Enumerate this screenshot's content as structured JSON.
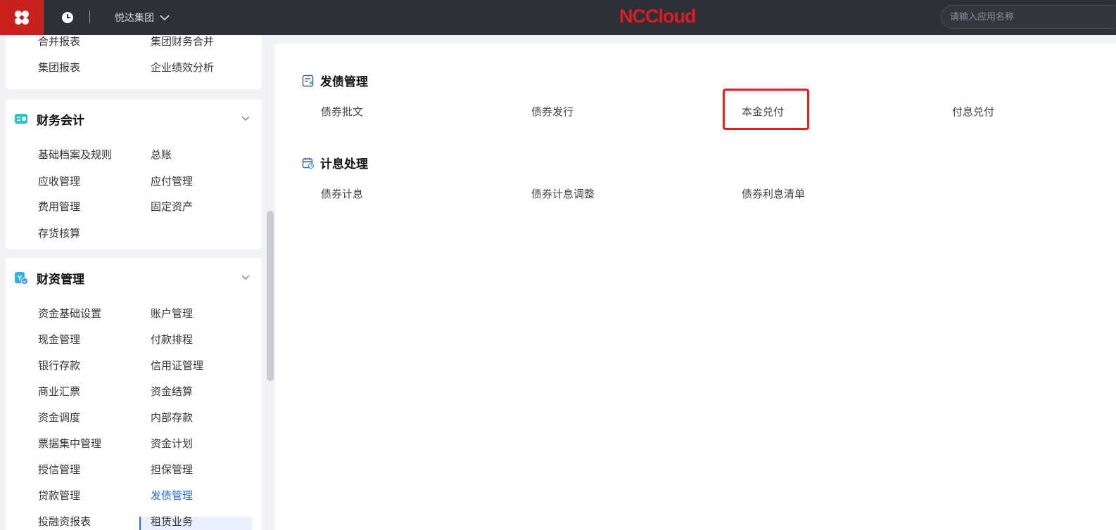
{
  "topbar": {
    "group_name": "悦达集团",
    "brand": "NCCloud",
    "search_placeholder": "请输入应用名称"
  },
  "sidebar": {
    "card0_items": [
      "合并报表",
      "集团财务合并",
      "集团报表",
      "企业绩效分析"
    ],
    "card1": {
      "title": "财务会计",
      "items": [
        "基础档案及规则",
        "总账",
        "应收管理",
        "应付管理",
        "费用管理",
        "固定资产",
        "存货核算"
      ]
    },
    "card2": {
      "title": "财资管理",
      "items": [
        "资金基础设置",
        "账户管理",
        "现金管理",
        "付款排程",
        "银行存款",
        "信用证管理",
        "商业汇票",
        "资金结算",
        "资金调度",
        "内部存款",
        "票据集中管理",
        "资金计划",
        "授信管理",
        "担保管理",
        "贷款管理",
        "发债管理",
        "投融资报表",
        "租赁业务"
      ],
      "active_item": "发债管理"
    }
  },
  "main": {
    "sections": [
      {
        "title": "发债管理",
        "links": [
          "债券批文",
          "债券发行",
          "本金兑付",
          "付息兑付"
        ]
      },
      {
        "title": "计息处理",
        "links": [
          "债券计息",
          "债券计息调整",
          "债券利息清单"
        ]
      }
    ],
    "highlighted_link": "本金兑付"
  },
  "colors": {
    "topbar": "#2d3039",
    "logo_bg": "#c8201f",
    "brand": "#e01b22",
    "active": "#1f6ad9",
    "highlight": "#ee1c1c"
  }
}
